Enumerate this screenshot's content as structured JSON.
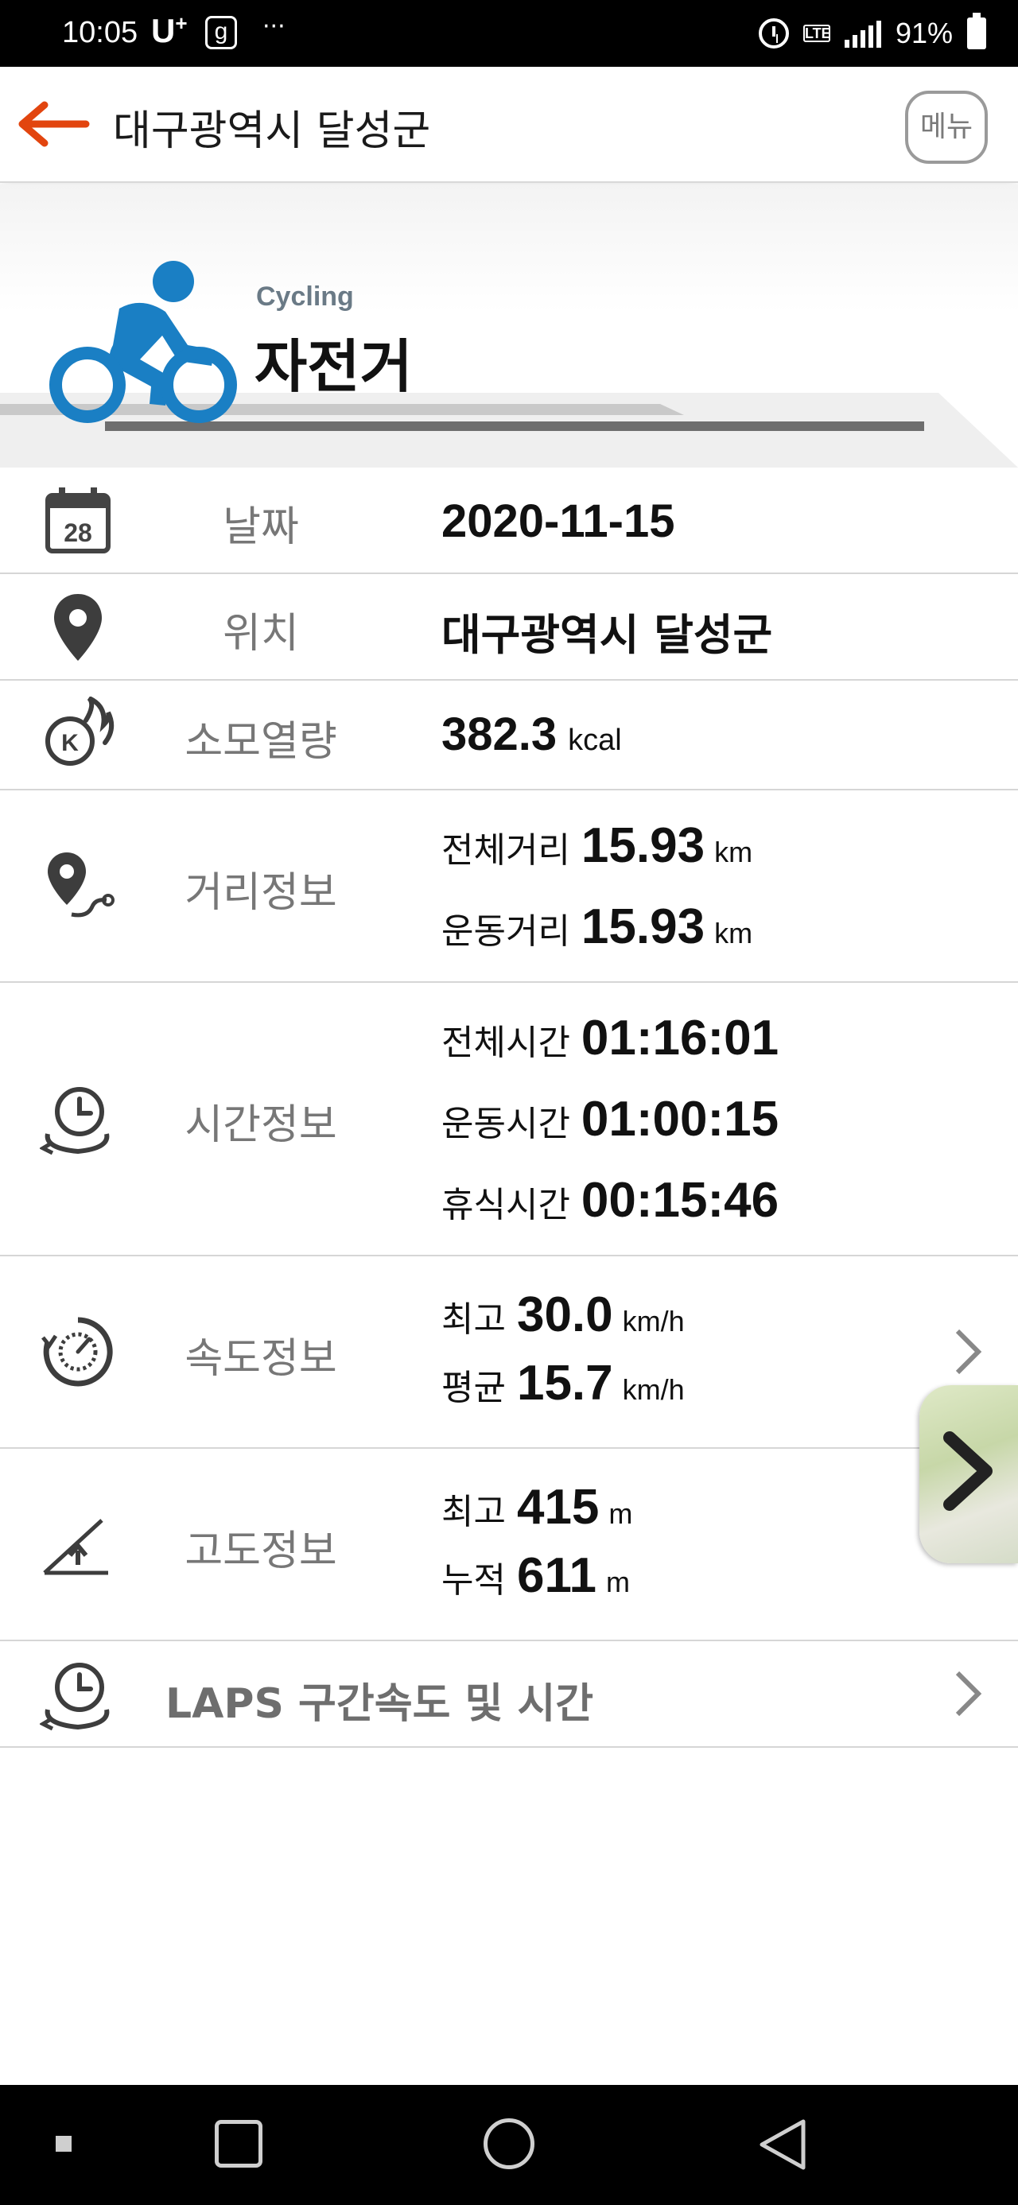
{
  "status_bar": {
    "time": "10:05",
    "carrier": "U",
    "carrier_sup": "+",
    "carrier_badge": "g",
    "more": "···",
    "battery": "91%"
  },
  "app_bar": {
    "title": "대구광역시 달성군",
    "menu_label": "메뉴"
  },
  "header": {
    "sport_en": "Cycling",
    "sport_ko": "자전거"
  },
  "rows": {
    "date": {
      "label": "날짜",
      "value": "2020-11-15",
      "icon_day": "28"
    },
    "location": {
      "label": "위치",
      "value": "대구광역시 달성군"
    },
    "calories": {
      "label": "소모열량",
      "value": "382.3",
      "unit": "kcal"
    },
    "distance": {
      "label": "거리정보",
      "total_key": "전체거리",
      "total_value": "15.93",
      "total_unit": "km",
      "moving_key": "운동거리",
      "moving_value": "15.93",
      "moving_unit": "km"
    },
    "time": {
      "label": "시간정보",
      "total_key": "전체시간",
      "total_value": "01:16:01",
      "moving_key": "운동시간",
      "moving_value": "01:00:15",
      "rest_key": "휴식시간",
      "rest_value": "00:15:46"
    },
    "speed": {
      "label": "속도정보",
      "max_key": "최고",
      "max_value": "30.0",
      "max_unit": "km/h",
      "avg_key": "평균",
      "avg_value": "15.7",
      "avg_unit": "km/h"
    },
    "altitude": {
      "label": "고도정보",
      "max_key": "최고",
      "max_value": "415",
      "max_unit": "m",
      "cum_key": "누적",
      "cum_value": "611",
      "cum_unit": "m"
    },
    "laps": {
      "label": "LAPS 구간속도 및 시간"
    }
  },
  "colors": {
    "accent_orange": "#e2450f",
    "cyclist_blue": "#1a7fc4",
    "label_gray": "#777777"
  },
  "icons": {
    "back": "back-arrow-icon",
    "date": "calendar-icon",
    "location": "map-pin-icon",
    "calories": "calorie-flame-icon",
    "distance": "route-pin-icon",
    "time": "clock-cycle-icon",
    "speed": "speedometer-icon",
    "altitude": "altitude-slope-icon",
    "laps": "laps-clock-icon"
  }
}
